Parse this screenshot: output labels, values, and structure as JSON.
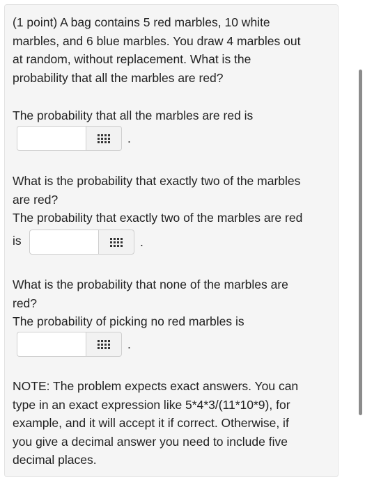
{
  "problem": {
    "intro_lines": [
      "(1 point) A bag contains 5 red marbles, 10 white",
      "marbles, and 6 blue marbles. You draw 4 marbles out",
      "at random, without replacement. What is the",
      "probability that all the marbles are red?"
    ],
    "q1_prompt": "The probability that all the marbles are red is",
    "q2_question_lines": [
      "What is the probability that exactly two of the marbles",
      "are red?"
    ],
    "q2_prompt": "The probability that exactly two of the marbles are red",
    "q2_prompt_cont": "is",
    "q3_question_lines": [
      "What is the probability that none of the marbles are",
      "red?"
    ],
    "q3_prompt": "The probability of picking no red marbles is",
    "note_lines": [
      "NOTE: The problem expects exact answers. You can",
      "type in an exact expression like 5*4*3/(11*10*9), for",
      "example, and it will accept it if correct. Otherwise, if",
      "you give a decimal answer you need to include five",
      "decimal places."
    ]
  },
  "answers": [
    {
      "value": "",
      "period": "."
    },
    {
      "value": "",
      "period": "."
    },
    {
      "value": "",
      "period": "."
    }
  ],
  "icons": {
    "palette_button_icon": "equation-palette-grid-icon"
  }
}
